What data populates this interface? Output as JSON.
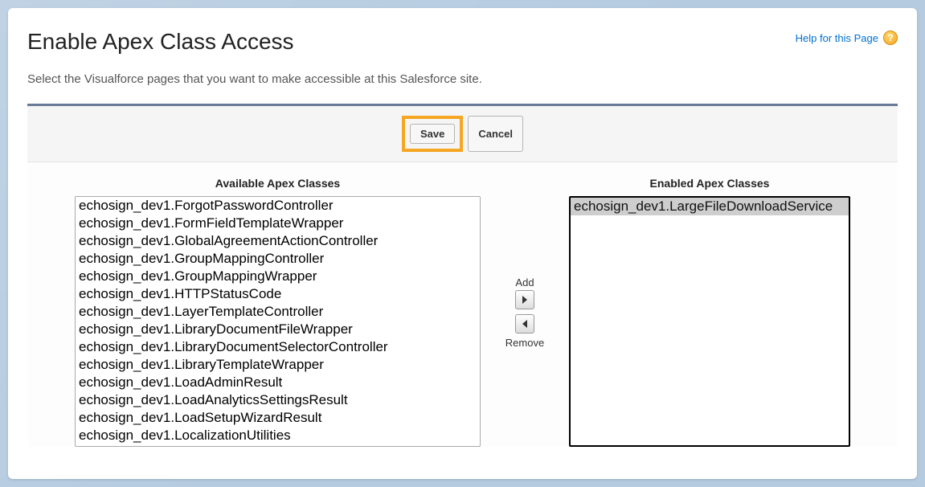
{
  "header": {
    "title": "Enable Apex Class Access",
    "help_label": "Help for this Page"
  },
  "description": "Select the Visualforce pages that you want to make accessible at this Salesforce site.",
  "toolbar": {
    "save_label": "Save",
    "cancel_label": "Cancel"
  },
  "picker": {
    "available_label": "Available Apex Classes",
    "enabled_label": "Enabled Apex Classes",
    "add_label": "Add",
    "remove_label": "Remove",
    "available_items": [
      "echosign_dev1.ForgotPasswordController",
      "echosign_dev1.FormFieldTemplateWrapper",
      "echosign_dev1.GlobalAgreementActionController",
      "echosign_dev1.GroupMappingController",
      "echosign_dev1.GroupMappingWrapper",
      "echosign_dev1.HTTPStatusCode",
      "echosign_dev1.LayerTemplateController",
      "echosign_dev1.LibraryDocumentFileWrapper",
      "echosign_dev1.LibraryDocumentSelectorController",
      "echosign_dev1.LibraryTemplateWrapper",
      "echosign_dev1.LoadAdminResult",
      "echosign_dev1.LoadAnalyticsSettingsResult",
      "echosign_dev1.LoadSetupWizardResult",
      "echosign_dev1.LocalizationUtilities"
    ],
    "enabled_items": [
      "echosign_dev1.LargeFileDownloadService"
    ]
  }
}
